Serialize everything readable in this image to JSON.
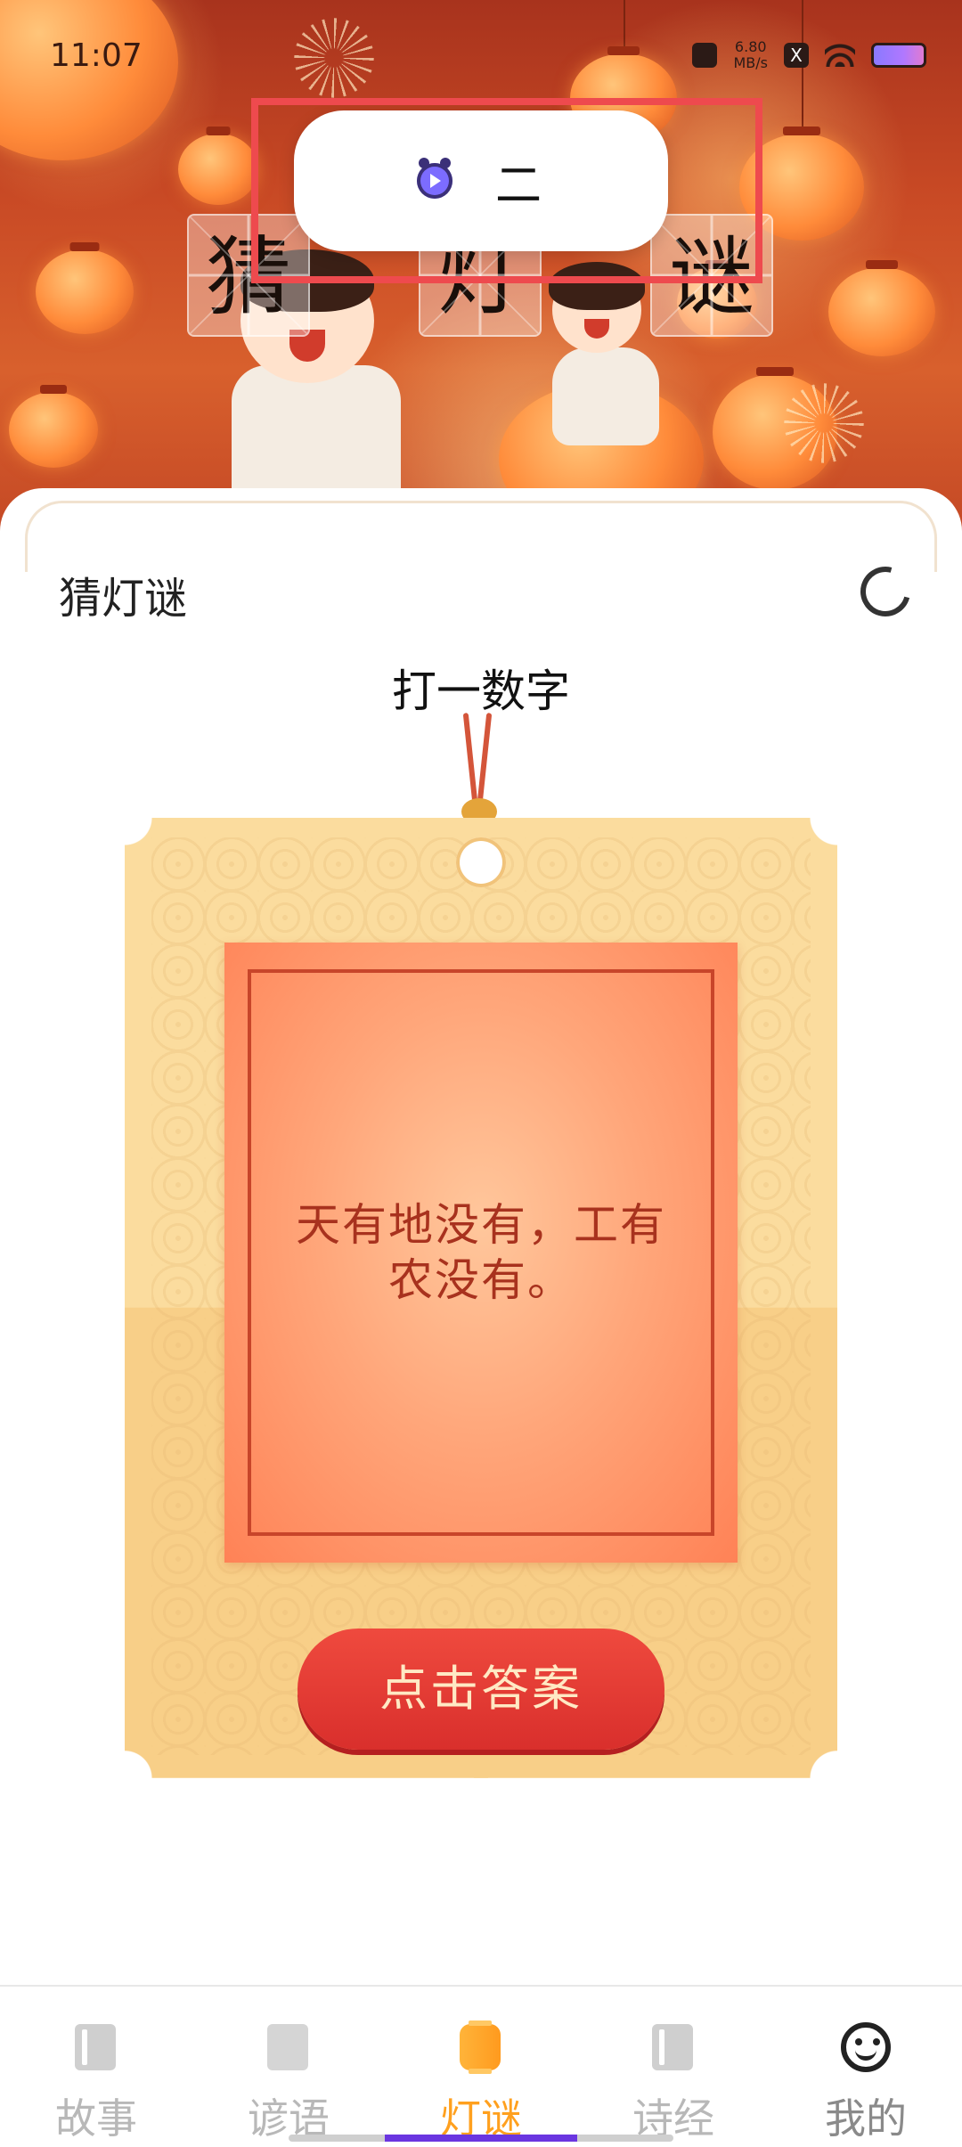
{
  "status_bar": {
    "time": "11:07",
    "net_speed_value": "6.80",
    "net_speed_unit": "MB/s",
    "x_label": "X"
  },
  "banner": {
    "title_chars": [
      "猜",
      "灯",
      "谜"
    ]
  },
  "popup": {
    "text": "二",
    "app_icon": "video-app-icon"
  },
  "page": {
    "title": "猜灯谜",
    "refresh_icon": "refresh-icon"
  },
  "riddle": {
    "category": "打一数字",
    "question": "天有地没有，工有农没有。",
    "answer_button": "点击答案"
  },
  "bottom_nav": {
    "items": [
      {
        "label": "故事",
        "icon": "book-icon"
      },
      {
        "label": "谚语",
        "icon": "dictionary-icon"
      },
      {
        "label": "灯谜",
        "icon": "lantern-icon",
        "active": true
      },
      {
        "label": "诗经",
        "icon": "book-icon"
      },
      {
        "label": "我的",
        "icon": "face-icon"
      }
    ]
  },
  "colors": {
    "accent": "#ffa01e",
    "button": "#e0342f",
    "highlight_box": "#ee4a4e"
  }
}
